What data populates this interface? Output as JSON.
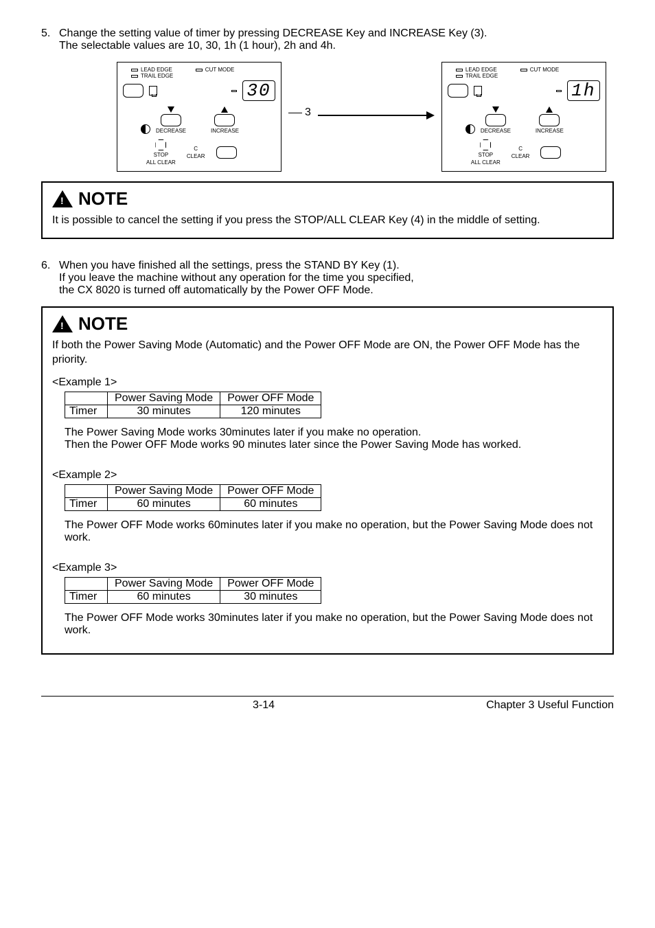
{
  "step5": {
    "num": "5.",
    "line1": "Change the setting value of timer by pressing DECREASE Key and INCREASE Key (3).",
    "line2": "The selectable values are 10, 30, 1h (1 hour), 2h and 4h."
  },
  "panel": {
    "lead_edge": "LEAD EDGE",
    "cut_mode": "CUT MODE",
    "trail_edge": "TRAIL EDGE",
    "decrease": "DECREASE",
    "increase": "INCREASE",
    "stop": "STOP",
    "all_clear": "ALL CLEAR",
    "clear": "CLEAR",
    "c": "C",
    "seg_left": "30",
    "seg_right": "1h"
  },
  "ref3": "3",
  "note1": {
    "title": "NOTE",
    "body": "It is possible to cancel the setting if you press the STOP/ALL CLEAR Key (4) in the middle of setting."
  },
  "step6": {
    "num": "6.",
    "line1": "When you have finished all the settings, press the STAND BY Key (1).",
    "line2": "If you leave the machine without any operation for the time you specified,",
    "line3": "the CX 8020 is turned off automatically by the Power OFF Mode."
  },
  "note2": {
    "title": "NOTE",
    "intro": "If both the Power Saving Mode (Automatic) and the Power OFF Mode are ON, the Power OFF Mode has the priority.",
    "ex1_label": "<Example 1>",
    "ex2_label": "<Example 2>",
    "ex3_label": "<Example 3>",
    "th1": "Power Saving Mode",
    "th2": "Power OFF Mode",
    "timer": "Timer",
    "ex1_v1": "30 minutes",
    "ex1_v2": "120 minutes",
    "ex1_exp1": "The Power Saving Mode works 30minutes later if you make no operation.",
    "ex1_exp2": "Then the Power OFF Mode works 90 minutes later since the Power Saving Mode has worked.",
    "ex2_v1": "60 minutes",
    "ex2_v2": "60 minutes",
    "ex2_exp": "The Power OFF Mode works 60minutes later if you make no operation, but the Power Saving Mode does not work.",
    "ex3_v1": "60 minutes",
    "ex3_v2": "30 minutes",
    "ex3_exp": "The Power OFF Mode works 30minutes later if you make no operation, but the Power Saving Mode does not work."
  },
  "footer": {
    "page": "3-14",
    "chapter": "Chapter 3     Useful Function"
  }
}
